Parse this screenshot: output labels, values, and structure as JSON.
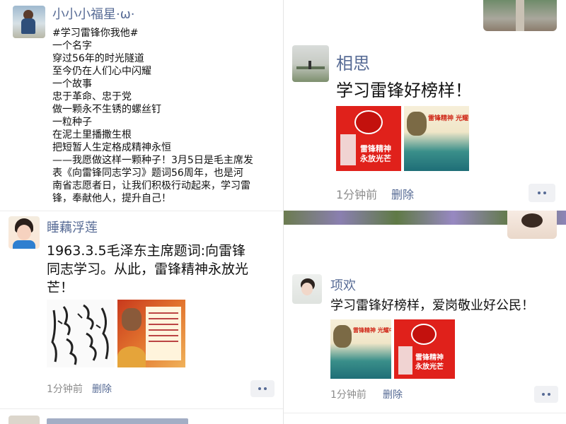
{
  "left": {
    "post1": {
      "name": "小小小福星·ω·",
      "lines": [
        "#学习雷锋你我他#",
        "一个名字",
        "穿过56年的时光隧道",
        "至今仍在人们心中闪耀",
        "一个故事",
        "忠于革命、忠于党",
        "做一颗永不生锈的螺丝钉",
        "一粒种子",
        "在泥土里播撒生根",
        "把短暂人生定格成精神永恒",
        "——我愿做这样一颗种子！3月5日是毛主席发",
        "表《向雷锋同志学习》题词56周年，也是河",
        "南省志愿者日，让我们积极行动起来，学习雷",
        "锋，奉献他人，提升自己！"
      ]
    },
    "post2": {
      "name": "睡藕浮莲",
      "lines": [
        "1963.3.5毛泽东主席题词:向雷锋",
        "同志学习。从此，雷锋精神永放光",
        "芒！"
      ],
      "time": "1分钟前",
      "delete": "删除"
    }
  },
  "right": {
    "post1": {
      "name": "相思",
      "text": "学习雷锋好榜样！",
      "poster1_text": "雷锋精神\n永放光芒",
      "poster2_text": "雷锋精神  光耀中",
      "time": "1分钟前",
      "delete": "删除"
    },
    "post2": {
      "name": "项欢",
      "text": "学习雷锋好榜样，爱岗敬业好公民！",
      "poster1_text": "雷锋精神  光耀中",
      "poster2_text": "雷锋精神\n永放光芒",
      "time": "1分钟前",
      "delete": "删除"
    }
  }
}
